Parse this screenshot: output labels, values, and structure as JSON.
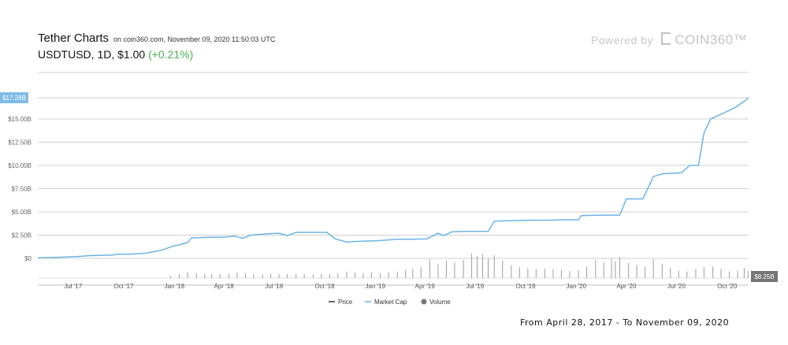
{
  "header": {
    "title": "Tether Charts",
    "source": "on coin360.com, November 09, 2020 11:50:03 UTC",
    "symbol_line": "USDTUSD, 1D, $1.00",
    "change": "(+0.21%)"
  },
  "branding": {
    "powered_by": "Powered by",
    "brand": "COIN360™"
  },
  "date_range": "From April 28, 2017 - To November 09, 2020",
  "colors": {
    "market_cap": "#6cb4e6",
    "volume": "#9e9e9e",
    "grid": "#cfcfcf",
    "price": "#333333",
    "change": "#4caf50"
  },
  "chart_data": {
    "type": "line",
    "title": "Tether Charts",
    "x_ticks": [
      "Jul '17",
      "Oct '17",
      "Jan '18",
      "Apr '18",
      "Jul '18",
      "Oct '18",
      "Jan '19",
      "Apr '19",
      "Jul '19",
      "Oct '19",
      "Jan '20",
      "Apr '20",
      "Jul '20",
      "Oct '20"
    ],
    "y_ticks": [
      "$0",
      "$2.50B",
      "$5.00B",
      "$7.50B",
      "$10.00B",
      "$12.50B",
      "$15.00B",
      "$17.28B"
    ],
    "ylim": [
      0,
      20
    ],
    "current_market_cap_label": "$17.28B",
    "current_volume_label": "$8.25B",
    "legend": [
      "Price",
      "Market Cap",
      "Volume"
    ],
    "legend_position": "bottom-center",
    "series": [
      {
        "name": "Market Cap",
        "unit": "USD billions",
        "points": [
          [
            "2017-04-28",
            0.05
          ],
          [
            "2017-06-01",
            0.1
          ],
          [
            "2017-07-10",
            0.2
          ],
          [
            "2017-08-01",
            0.3
          ],
          [
            "2017-09-10",
            0.35
          ],
          [
            "2017-09-20",
            0.45
          ],
          [
            "2017-10-10",
            0.45
          ],
          [
            "2017-11-10",
            0.55
          ],
          [
            "2017-12-10",
            0.9
          ],
          [
            "2017-12-28",
            1.3
          ],
          [
            "2018-01-10",
            1.45
          ],
          [
            "2018-01-25",
            1.7
          ],
          [
            "2018-02-01",
            2.2
          ],
          [
            "2018-03-01",
            2.25
          ],
          [
            "2018-04-05",
            2.3
          ],
          [
            "2018-04-20",
            2.4
          ],
          [
            "2018-05-05",
            2.15
          ],
          [
            "2018-05-20",
            2.5
          ],
          [
            "2018-06-20",
            2.65
          ],
          [
            "2018-07-10",
            2.7
          ],
          [
            "2018-07-25",
            2.45
          ],
          [
            "2018-08-10",
            2.8
          ],
          [
            "2018-09-01",
            2.8
          ],
          [
            "2018-10-05",
            2.8
          ],
          [
            "2018-10-20",
            2.1
          ],
          [
            "2018-11-10",
            1.75
          ],
          [
            "2018-12-05",
            1.85
          ],
          [
            "2019-01-05",
            1.9
          ],
          [
            "2019-02-10",
            2.05
          ],
          [
            "2019-03-10",
            2.05
          ],
          [
            "2019-04-05",
            2.1
          ],
          [
            "2019-04-25",
            2.7
          ],
          [
            "2019-05-05",
            2.45
          ],
          [
            "2019-05-20",
            2.85
          ],
          [
            "2019-06-10",
            2.9
          ],
          [
            "2019-07-25",
            2.9
          ],
          [
            "2019-08-05",
            4.0
          ],
          [
            "2019-09-01",
            4.05
          ],
          [
            "2019-10-05",
            4.1
          ],
          [
            "2019-11-10",
            4.1
          ],
          [
            "2019-12-10",
            4.15
          ],
          [
            "2020-01-05",
            4.15
          ],
          [
            "2020-01-10",
            4.6
          ],
          [
            "2020-02-20",
            4.65
          ],
          [
            "2020-03-20",
            4.65
          ],
          [
            "2020-04-01",
            6.4
          ],
          [
            "2020-05-01",
            6.4
          ],
          [
            "2020-05-20",
            8.8
          ],
          [
            "2020-06-05",
            9.1
          ],
          [
            "2020-07-10",
            9.2
          ],
          [
            "2020-07-25",
            10.0
          ],
          [
            "2020-08-10",
            10.0
          ],
          [
            "2020-08-20",
            13.5
          ],
          [
            "2020-09-01",
            15.0
          ],
          [
            "2020-09-20",
            15.5
          ],
          [
            "2020-10-15",
            16.2
          ],
          [
            "2020-11-01",
            16.9
          ],
          [
            "2020-11-09",
            17.3
          ]
        ]
      },
      {
        "name": "Volume",
        "unit": "relative",
        "points": [
          [
            "2017-12-25",
            0.3
          ],
          [
            "2018-01-10",
            0.55
          ],
          [
            "2018-01-25",
            0.8
          ],
          [
            "2018-02-10",
            0.7
          ],
          [
            "2018-02-25",
            0.6
          ],
          [
            "2018-03-10",
            0.5
          ],
          [
            "2018-03-25",
            0.55
          ],
          [
            "2018-04-10",
            0.6
          ],
          [
            "2018-04-25",
            0.8
          ],
          [
            "2018-05-10",
            0.7
          ],
          [
            "2018-05-25",
            0.55
          ],
          [
            "2018-06-10",
            0.5
          ],
          [
            "2018-06-25",
            0.6
          ],
          [
            "2018-07-10",
            0.55
          ],
          [
            "2018-07-25",
            0.5
          ],
          [
            "2018-08-10",
            0.6
          ],
          [
            "2018-08-25",
            0.55
          ],
          [
            "2018-09-10",
            0.5
          ],
          [
            "2018-09-25",
            0.55
          ],
          [
            "2018-10-10",
            0.6
          ],
          [
            "2018-10-25",
            0.7
          ],
          [
            "2018-11-10",
            0.9
          ],
          [
            "2018-11-25",
            0.8
          ],
          [
            "2018-12-10",
            0.7
          ],
          [
            "2018-12-25",
            0.75
          ],
          [
            "2019-01-10",
            0.7
          ],
          [
            "2019-01-25",
            0.8
          ],
          [
            "2019-02-10",
            0.9
          ],
          [
            "2019-02-25",
            1.1
          ],
          [
            "2019-03-10",
            1.3
          ],
          [
            "2019-03-25",
            1.5
          ],
          [
            "2019-04-10",
            2.6
          ],
          [
            "2019-04-25",
            2.0
          ],
          [
            "2019-05-10",
            2.4
          ],
          [
            "2019-05-25",
            2.2
          ],
          [
            "2019-06-10",
            2.5
          ],
          [
            "2019-06-25",
            3.4
          ],
          [
            "2019-07-05",
            3.0
          ],
          [
            "2019-07-15",
            3.3
          ],
          [
            "2019-07-25",
            2.7
          ],
          [
            "2019-08-05",
            3.2
          ],
          [
            "2019-08-20",
            2.4
          ],
          [
            "2019-09-05",
            1.8
          ],
          [
            "2019-09-20",
            1.5
          ],
          [
            "2019-10-05",
            1.3
          ],
          [
            "2019-10-20",
            1.2
          ],
          [
            "2019-11-05",
            1.3
          ],
          [
            "2019-11-20",
            1.2
          ],
          [
            "2019-12-05",
            1.1
          ],
          [
            "2019-12-20",
            1.0
          ],
          [
            "2020-01-05",
            1.1
          ],
          [
            "2020-01-20",
            1.6
          ],
          [
            "2020-02-05",
            2.5
          ],
          [
            "2020-02-20",
            2.2
          ],
          [
            "2020-03-05",
            2.7
          ],
          [
            "2020-03-12",
            2.3
          ],
          [
            "2020-03-20",
            2.9
          ],
          [
            "2020-04-05",
            2.1
          ],
          [
            "2020-04-20",
            1.8
          ],
          [
            "2020-05-05",
            1.6
          ],
          [
            "2020-05-20",
            2.6
          ],
          [
            "2020-06-05",
            2.0
          ],
          [
            "2020-06-20",
            1.4
          ],
          [
            "2020-07-05",
            1.0
          ],
          [
            "2020-07-20",
            0.9
          ],
          [
            "2020-08-05",
            1.3
          ],
          [
            "2020-08-20",
            1.5
          ],
          [
            "2020-09-05",
            1.6
          ],
          [
            "2020-09-20",
            1.3
          ],
          [
            "2020-10-05",
            0.9
          ],
          [
            "2020-10-20",
            1.0
          ],
          [
            "2020-11-01",
            1.4
          ],
          [
            "2020-11-08",
            1.0
          ]
        ]
      }
    ]
  }
}
